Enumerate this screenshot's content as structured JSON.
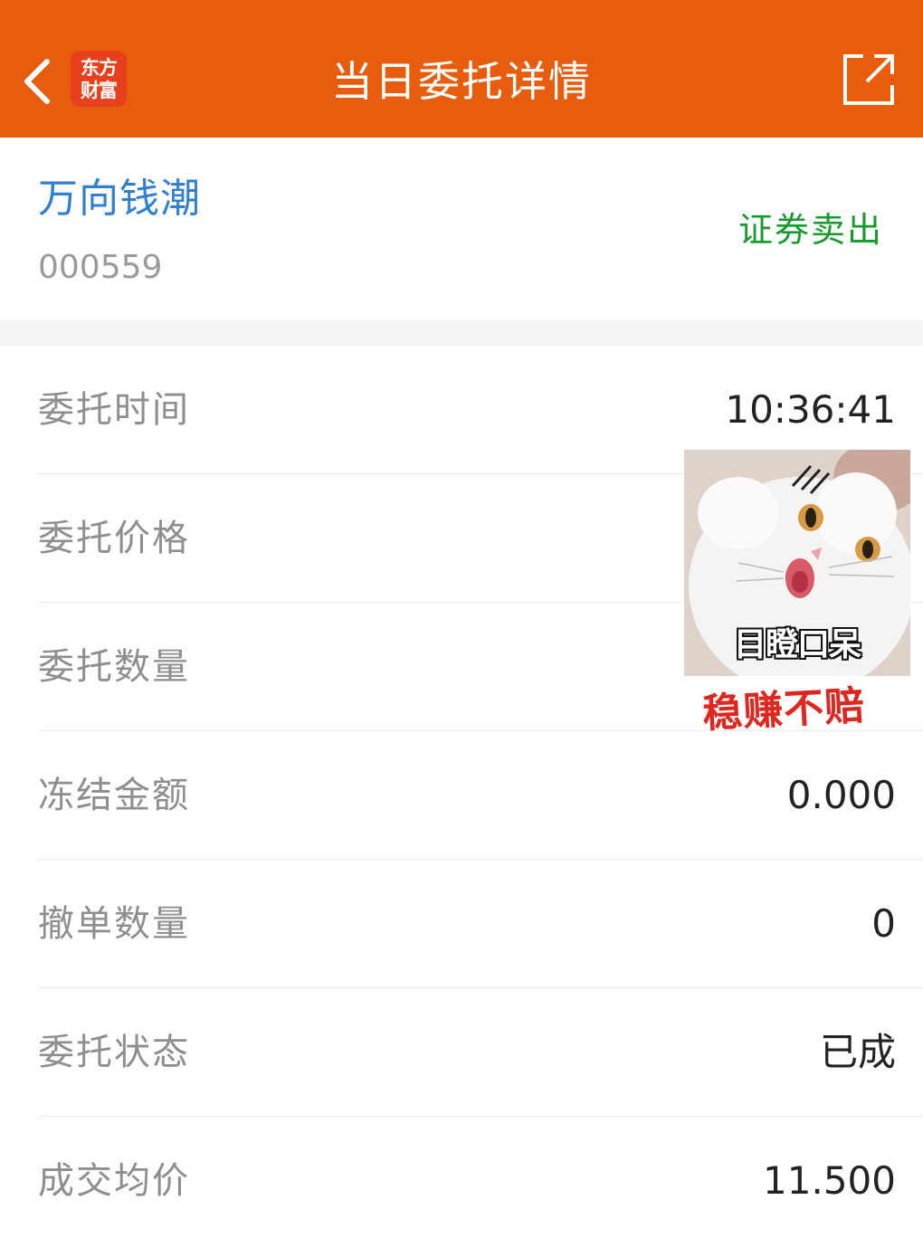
{
  "header": {
    "title": "当日委托详情",
    "logo_line1": "东方",
    "logo_line2": "财富",
    "back_icon": "chevron-left-icon",
    "share_icon": "share-icon",
    "bg_color": "#e85c0d"
  },
  "stock": {
    "name": "万向钱潮",
    "code": "000559",
    "trade_type": "证券卖出",
    "name_color": "#2f80d0",
    "trade_type_color": "#1a9a2e"
  },
  "details": [
    {
      "label": "委托时间",
      "value": "10:36:41"
    },
    {
      "label": "委托价格",
      "value": ""
    },
    {
      "label": "委托数量",
      "value": ""
    },
    {
      "label": "冻结金额",
      "value": "0.000"
    },
    {
      "label": "撤单数量",
      "value": "0"
    },
    {
      "label": "委托状态",
      "value": "已成"
    },
    {
      "label": "成交均价",
      "value": "11.500"
    }
  ],
  "sticker": {
    "caption": "目瞪口呆",
    "overlay_text": "稳赚不赔"
  }
}
